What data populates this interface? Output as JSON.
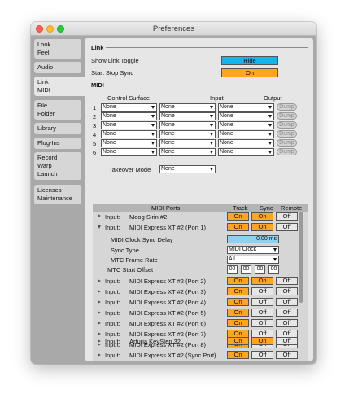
{
  "window": {
    "title": "Preferences"
  },
  "sidebar": {
    "tabs": [
      {
        "line1": "Look",
        "line2": "Feel"
      },
      {
        "line1": "Audio",
        "line2": ""
      },
      {
        "line1": "Link",
        "line2": "MIDI"
      },
      {
        "line1": "File",
        "line2": "Folder"
      },
      {
        "line1": "Library",
        "line2": ""
      },
      {
        "line1": "Plug-Ins",
        "line2": ""
      },
      {
        "line1": "Record",
        "line2": "Warp",
        "line3": "Launch"
      },
      {
        "line1": "Licenses",
        "line2": "Maintenance"
      }
    ]
  },
  "link": {
    "header": "Link",
    "show_link_toggle_label": "Show Link Toggle",
    "show_link_toggle_value": "Hide",
    "start_stop_sync_label": "Start Stop Sync",
    "start_stop_sync_value": "On"
  },
  "midi": {
    "header": "MIDI",
    "col_control_surface": "Control Surface",
    "col_input": "Input",
    "col_output": "Output",
    "dump_label": "Dump",
    "rows": [
      {
        "num": "1",
        "surface": "None",
        "input": "None",
        "output": "None"
      },
      {
        "num": "2",
        "surface": "None",
        "input": "None",
        "output": "None"
      },
      {
        "num": "3",
        "surface": "None",
        "input": "None",
        "output": "None"
      },
      {
        "num": "4",
        "surface": "None",
        "input": "None",
        "output": "None"
      },
      {
        "num": "5",
        "surface": "None",
        "input": "None",
        "output": "None"
      },
      {
        "num": "6",
        "surface": "None",
        "input": "None",
        "output": "None"
      }
    ],
    "takeover_mode_label": "Takeover Mode",
    "takeover_mode_value": "None"
  },
  "ports": {
    "col_ports": "MIDI Ports",
    "col_track": "Track",
    "col_sync": "Sync",
    "col_remote": "Remote",
    "rows": [
      {
        "dir": "Input:",
        "name": "Moog Sirin #2",
        "track": "On",
        "sync": "On",
        "remote": "Off"
      },
      {
        "dir": "Input:",
        "name": "MIDI Express XT #2 (Port 1)",
        "track": "On",
        "sync": "On",
        "remote": "Off"
      },
      {
        "dir": "Input:",
        "name": "MIDI Express XT #2 (Port 2)",
        "track": "On",
        "sync": "On",
        "remote": "Off"
      },
      {
        "dir": "Input:",
        "name": "MIDI Express XT #2 (Port 3)",
        "track": "On",
        "sync": "Off",
        "remote": "Off"
      },
      {
        "dir": "Input:",
        "name": "MIDI Express XT #2 (Port 4)",
        "track": "On",
        "sync": "Off",
        "remote": "Off"
      },
      {
        "dir": "Input:",
        "name": "MIDI Express XT #2 (Port 5)",
        "track": "On",
        "sync": "Off",
        "remote": "Off"
      },
      {
        "dir": "Input:",
        "name": "MIDI Express XT #2 (Port 6)",
        "track": "On",
        "sync": "Off",
        "remote": "Off"
      },
      {
        "dir": "Input:",
        "name": "MIDI Express XT #2 (Port 7)",
        "track": "On",
        "sync": "Off",
        "remote": "Off"
      },
      {
        "dir": "Input:",
        "name": "MIDI Express XT #2 (Port 8)",
        "track": "On",
        "sync": "Off",
        "remote": "Off"
      },
      {
        "dir": "Input:",
        "name": "MIDI Express XT #2 (Sync Port)",
        "track": "On",
        "sync": "Off",
        "remote": "Off"
      },
      {
        "dir": "Input:",
        "name": "Arturia KeyStep 32",
        "track": "On",
        "sync": "On",
        "remote": "Off"
      }
    ],
    "detail": {
      "clock_delay_label": "MIDI Clock Sync Delay",
      "clock_delay_value": "0.00 ms",
      "sync_type_label": "Sync Type",
      "sync_type_value": "MIDI Clock",
      "mtc_frame_rate_label": "MTC Frame Rate",
      "mtc_frame_rate_value": "All",
      "mtc_start_offset_label": "MTC Start Offset",
      "mtc_start_offset_values": [
        "00",
        "00",
        "00",
        "00"
      ]
    }
  },
  "colors": {
    "accent_orange": "#ffa51f",
    "accent_blue": "#18b4e6",
    "field_blue": "#8cd2f0"
  }
}
